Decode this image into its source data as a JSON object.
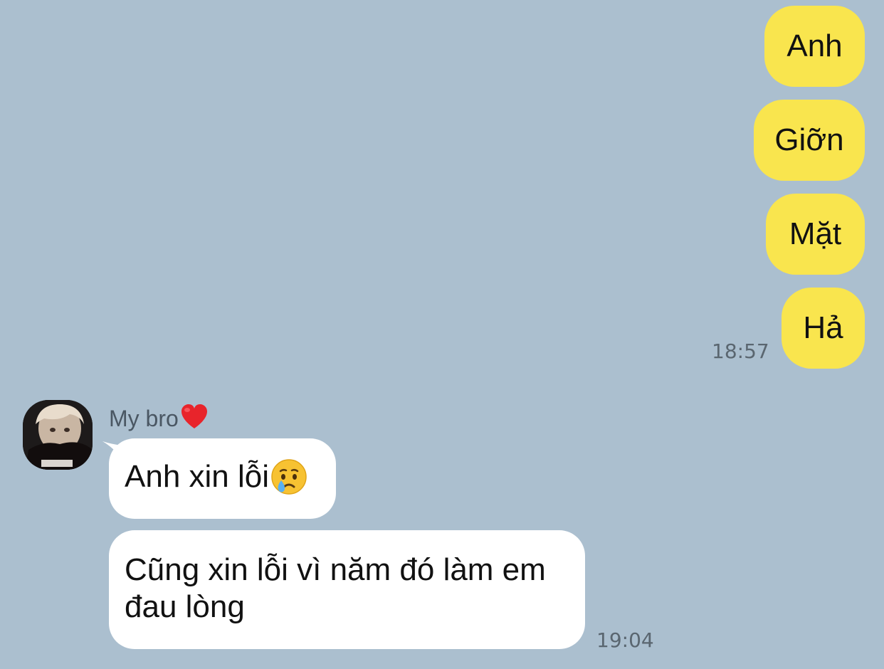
{
  "outgoing": [
    {
      "text": "Anh"
    },
    {
      "text": "Giỡn"
    },
    {
      "text": "Mặt"
    },
    {
      "text": "Hả"
    }
  ],
  "outgoing_time": "18:57",
  "incoming": {
    "sender_name": "My bro",
    "sender_emoji_icon": "red-heart-icon",
    "messages": [
      {
        "text": "Anh xin lỗi",
        "emoji_icon": "crying-face-icon"
      },
      {
        "text": "Cũng xin lỗi vì năm đó làm em đau lòng"
      }
    ],
    "time": "19:04"
  },
  "colors": {
    "background": "#abbfcf",
    "outgoing_bubble": "#f9e54e",
    "incoming_bubble": "#ffffff"
  }
}
